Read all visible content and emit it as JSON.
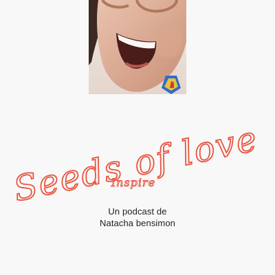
{
  "cover": {
    "title": "Seeds of love",
    "subtitle": "Inspire",
    "byline_line1": "Un podcast de",
    "byline_line2": "Natacha bensimon",
    "accent_color": "#e8533f",
    "photo_icon": "smiling-woman-portrait"
  }
}
